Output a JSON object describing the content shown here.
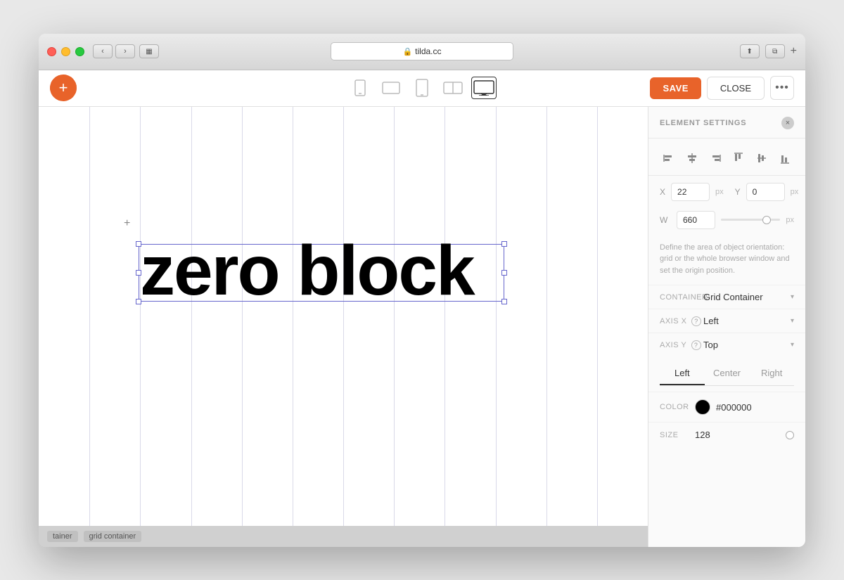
{
  "window": {
    "url": "tilda.cc",
    "lock_icon": "🔒"
  },
  "toolbar": {
    "save_label": "SAVE",
    "close_label": "CLOSE",
    "more_label": "...",
    "add_icon": "+"
  },
  "canvas": {
    "text_block": "zero block",
    "breadcrumbs": [
      "tainer",
      "grid container"
    ]
  },
  "panel": {
    "title": "ELEMENT SETTINGS",
    "close_icon": "×",
    "x_label": "X",
    "x_value": "22",
    "y_label": "Y",
    "y_value": "0",
    "w_label": "W",
    "w_value": "660",
    "px_unit": "px",
    "description": "Define the area of object orientation: grid or the whole browser window and set the origin position.",
    "container_label": "CONTAINER",
    "container_value": "Grid Container",
    "axis_x_label": "AXIS X",
    "axis_x_value": "Left",
    "axis_y_label": "AXIS Y",
    "axis_y_value": "Top",
    "align_tabs": [
      "Left",
      "Center",
      "Right"
    ],
    "active_tab": "Left",
    "color_label": "COLOR",
    "color_value": "#000000",
    "color_hex": "#000000",
    "size_label": "SIZE",
    "size_value": "128"
  },
  "devices": [
    {
      "id": "mobile-portrait",
      "icon": "📱"
    },
    {
      "id": "tablet-landscape",
      "icon": "⬜"
    },
    {
      "id": "tablet-portrait",
      "icon": "📱"
    },
    {
      "id": "desktop-split",
      "icon": "▭"
    },
    {
      "id": "desktop",
      "icon": "🖥",
      "active": true
    }
  ]
}
